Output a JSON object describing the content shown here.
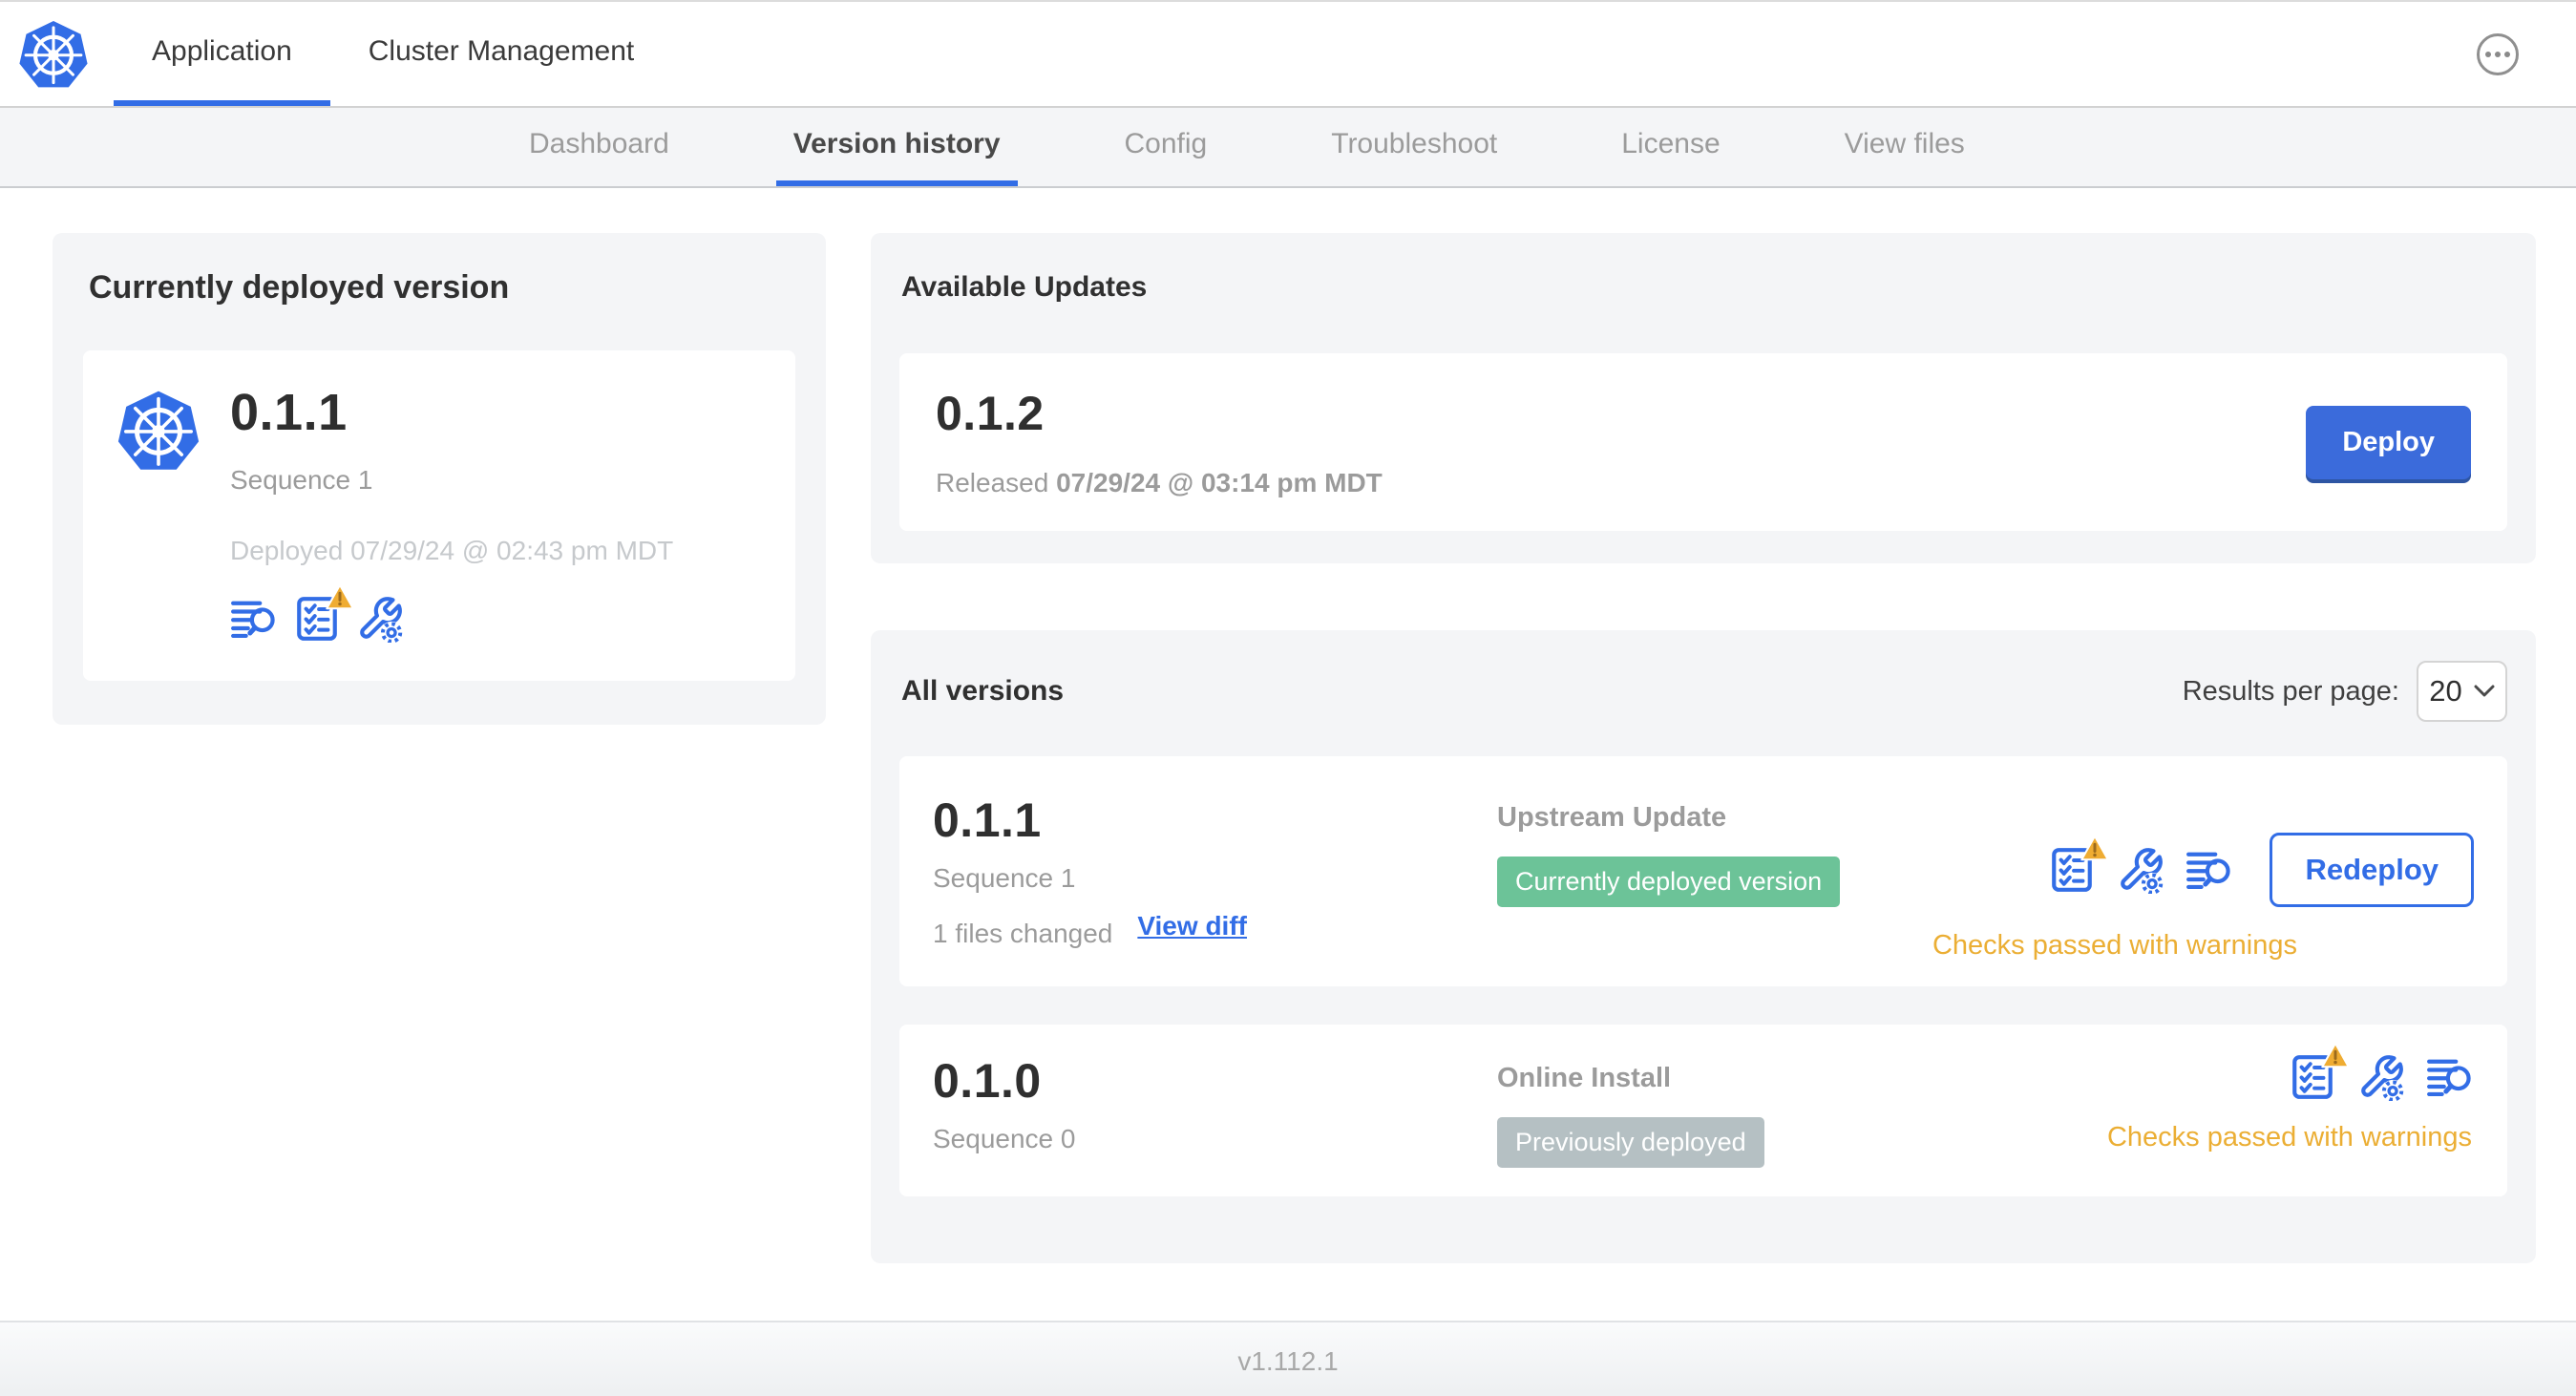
{
  "colors": {
    "accent_blue": "#326de6",
    "deploy_button_blue": "#3b6bdb",
    "success_green": "#6cc398",
    "neutral_badge_gray": "#b5c0c3",
    "warning_amber": "#ebae34"
  },
  "header": {
    "tabs": [
      {
        "label": "Application",
        "active": true
      },
      {
        "label": "Cluster Management",
        "active": false
      }
    ]
  },
  "subnav": {
    "items": [
      {
        "label": "Dashboard",
        "active": false
      },
      {
        "label": "Version history",
        "active": true
      },
      {
        "label": "Config",
        "active": false
      },
      {
        "label": "Troubleshoot",
        "active": false
      },
      {
        "label": "License",
        "active": false
      },
      {
        "label": "View files",
        "active": false
      }
    ]
  },
  "current_version": {
    "title": "Currently deployed version",
    "version": "0.1.1",
    "sequence": "Sequence 1",
    "deployed": "Deployed 07/29/24 @ 02:43 pm MDT"
  },
  "available_updates": {
    "title": "Available Updates",
    "version": "0.1.2",
    "released_label": "Released",
    "released_date": "07/29/24 @ 03:14 pm MDT",
    "deploy_button": "Deploy"
  },
  "all_versions": {
    "title": "All versions",
    "results_per_page_label": "Results per page:",
    "results_per_page": "20",
    "rows": [
      {
        "version": "0.1.1",
        "sequence": "Sequence 1",
        "files_changed": "1 files changed",
        "view_diff_link": "View diff",
        "source": "Upstream Update",
        "badge": "Currently deployed version",
        "status": "Checks passed with warnings",
        "action_button": "Redeploy"
      },
      {
        "version": "0.1.0",
        "sequence": "Sequence 0",
        "source": "Online Install",
        "badge": "Previously deployed",
        "status": "Checks passed with warnings"
      }
    ]
  },
  "footer": {
    "version": "v1.112.1"
  }
}
